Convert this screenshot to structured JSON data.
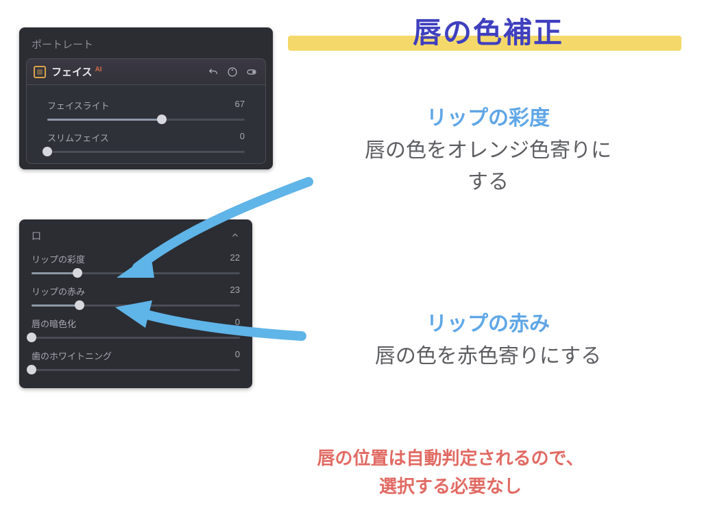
{
  "title": "唇の色補正",
  "panel_top": {
    "title": "ポートレート",
    "header": {
      "label": "フェイス",
      "ai": "AI"
    },
    "sliders": [
      {
        "label": "フェイスライト",
        "value": "67",
        "pct": 58
      },
      {
        "label": "スリムフェイス",
        "value": "0",
        "pct": 0
      }
    ]
  },
  "panel_bottom": {
    "section": "口",
    "sliders": [
      {
        "label": "リップの彩度",
        "value": "22",
        "pct": 22
      },
      {
        "label": "リップの赤み",
        "value": "23",
        "pct": 23
      },
      {
        "label": "唇の暗色化",
        "value": "0",
        "pct": 0
      },
      {
        "label": "歯のホワイトニング",
        "value": "0",
        "pct": 0
      }
    ]
  },
  "notes": {
    "n1_head": "リップの彩度",
    "n1_body1": "唇の色をオレンジ色寄りに",
    "n1_body2": "する",
    "n2_head": "リップの赤み",
    "n2_body": "唇の色を赤色寄りにする"
  },
  "footnote1": "唇の位置は自動判定されるので、",
  "footnote2": "選択する必要なし"
}
